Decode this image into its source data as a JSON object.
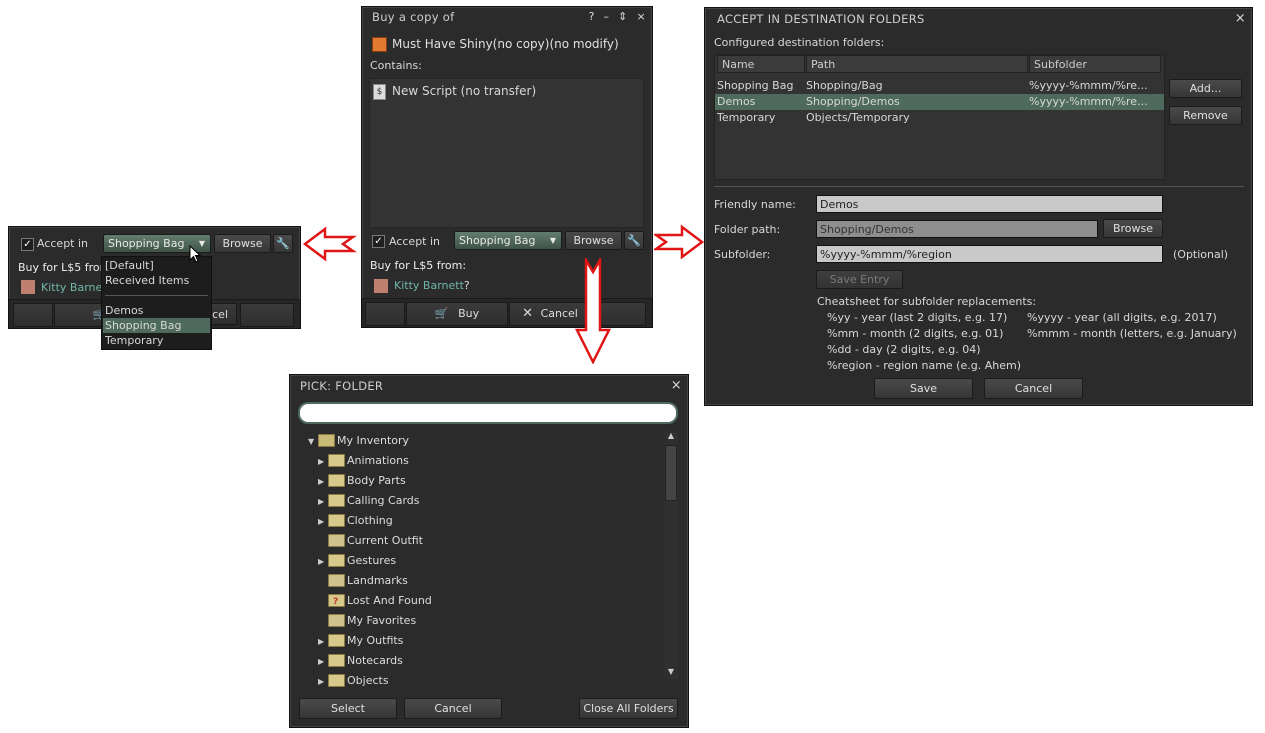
{
  "left_panel": {
    "accept_label": "Accept in",
    "combo_value": "Shopping Bag",
    "browse_label": "Browse",
    "buy_text": "Buy for L$5 from",
    "seller": "Kitty Barnett",
    "buy_label": "B",
    "cancel_label": "ncel",
    "dropdown": {
      "items": [
        "[Default]",
        "Received Items",
        "Demos",
        "Shopping Bag",
        "Temporary"
      ],
      "selected": "Shopping Bag"
    }
  },
  "buy_panel": {
    "title": "Buy a copy of",
    "title_icons": [
      "?",
      "–",
      "⇕",
      "×"
    ],
    "object_name": "Must Have Shiny(no copy)(no modify)",
    "contains_label": "Contains:",
    "contents": [
      "New Script (no transfer)"
    ],
    "accept_label": "Accept in",
    "combo_value": "Shopping Bag",
    "browse_label": "Browse",
    "buy_text": "Buy for L$5 from:",
    "seller": "Kitty Barnett",
    "seller_suffix": "?",
    "buy_label": "Buy",
    "cancel_label": "Cancel"
  },
  "accept_panel": {
    "title": "ACCEPT IN DESTINATION FOLDERS",
    "close": "×",
    "configured_label": "Configured destination folders:",
    "columns": [
      "Name",
      "Path",
      "Subfolder"
    ],
    "rows": [
      {
        "name": "Shopping Bag",
        "path": "Shopping/Bag",
        "subfolder": "%yyyy-%mmm/%re..."
      },
      {
        "name": "Demos",
        "path": "Shopping/Demos",
        "subfolder": "%yyyy-%mmm/%re..."
      },
      {
        "name": "Temporary",
        "path": "Objects/Temporary",
        "subfolder": ""
      }
    ],
    "add_label": "Add...",
    "remove_label": "Remove",
    "friendly_label": "Friendly name:",
    "friendly_value": "Demos",
    "path_label": "Folder path:",
    "path_value": "Shopping/Demos",
    "browse_label": "Browse",
    "subfolder_label": "Subfolder:",
    "subfolder_value": "%yyyy-%mmm/%region",
    "optional": "(Optional)",
    "save_entry": "Save Entry",
    "cheat_title": "Cheatsheet for subfolder replacements:",
    "cheat": [
      "%yy - year (last 2 digits, e.g. 17)",
      "%yyyy - year (all digits, e.g. 2017)",
      "%mm - month (2 digits, e.g. 01)",
      "%mmm - month (letters, e.g. January)",
      "%dd - day (2 digits, e.g. 04)",
      "%region - region name (e.g. Ahem)"
    ],
    "save_label": "Save",
    "cancel_label": "Cancel"
  },
  "pick_panel": {
    "title": "PICK: FOLDER",
    "close": "×",
    "search_value": "",
    "root": "My Inventory",
    "items": [
      {
        "label": "Animations",
        "expandable": true
      },
      {
        "label": "Body Parts",
        "expandable": true
      },
      {
        "label": "Calling Cards",
        "expandable": true
      },
      {
        "label": "Clothing",
        "expandable": true
      },
      {
        "label": "Current Outfit",
        "expandable": false
      },
      {
        "label": "Gestures",
        "expandable": true
      },
      {
        "label": "Landmarks",
        "expandable": false
      },
      {
        "label": "Lost And Found",
        "expandable": false
      },
      {
        "label": "My Favorites",
        "expandable": false
      },
      {
        "label": "My Outfits",
        "expandable": true
      },
      {
        "label": "Notecards",
        "expandable": true
      },
      {
        "label": "Objects",
        "expandable": true
      }
    ],
    "select_label": "Select",
    "cancel_label": "Cancel",
    "close_all_label": "Close All Folders"
  }
}
